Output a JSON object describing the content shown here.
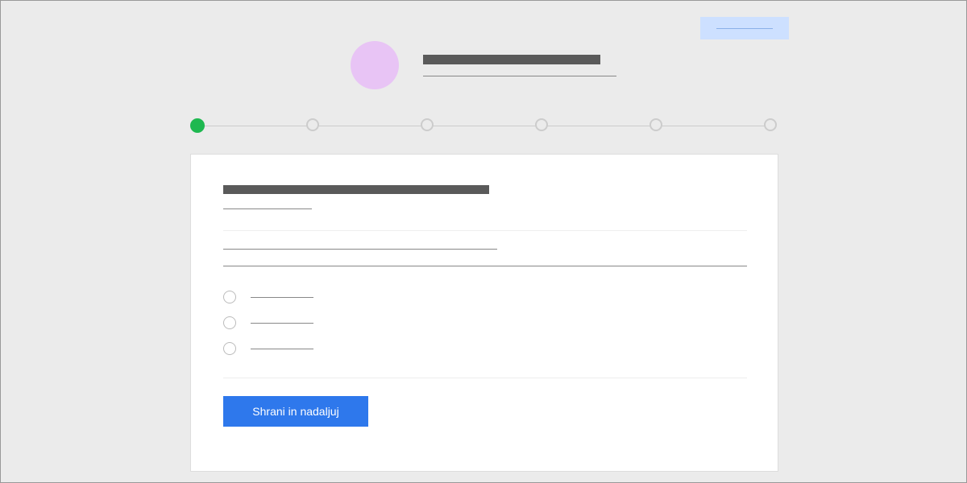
{
  "header": {
    "title_placeholder": "",
    "subtitle_placeholder": ""
  },
  "top_badge": "",
  "stepper": {
    "total_steps": 6,
    "current_step": 1
  },
  "form": {
    "heading_placeholder": "",
    "subheading_placeholder": "",
    "input1_placeholder": "",
    "input2_placeholder": "",
    "radios": [
      {
        "label": ""
      },
      {
        "label": ""
      },
      {
        "label": ""
      }
    ],
    "submit_label": "Shrani in nadaljuj"
  },
  "colors": {
    "accent_green": "#1eb850",
    "accent_blue": "#2e78ec",
    "avatar_bg": "#e8c4f5",
    "badge_bg": "#cde0ff"
  }
}
